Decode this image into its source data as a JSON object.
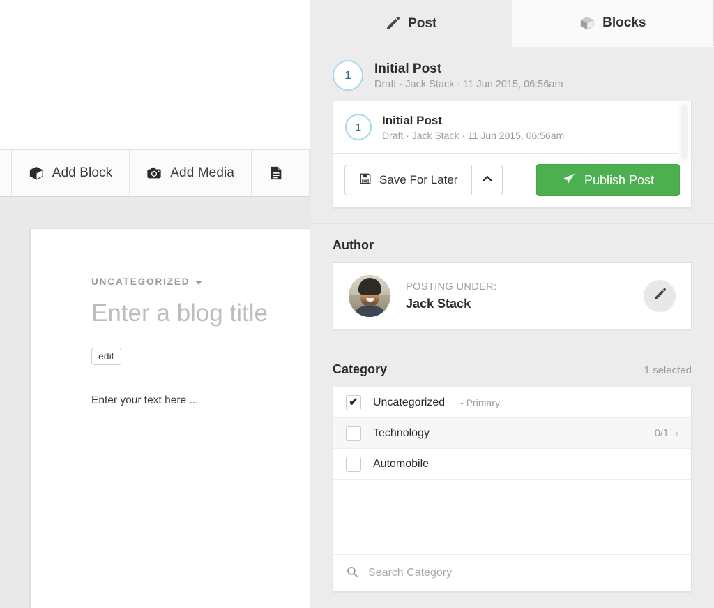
{
  "editor": {
    "toolbar": [
      {
        "label": "Add Block",
        "icon": "cube-icon"
      },
      {
        "label": "Add Media",
        "icon": "camera-icon"
      },
      {
        "label": "",
        "icon": "document-icon"
      }
    ],
    "category_chip": "UNCATEGORIZED",
    "title_placeholder": "Enter a blog title",
    "edit_label": "edit",
    "body_placeholder": "Enter your text here ..."
  },
  "sidebar": {
    "tabs": [
      {
        "label": "Post",
        "icon": "pencil-icon",
        "active": false
      },
      {
        "label": "Blocks",
        "icon": "cube-icon",
        "active": true
      }
    ],
    "post": {
      "number": "1",
      "title": "Initial Post",
      "meta": "Draft · Jack Stack · 11 Jun 2015, 06:56am",
      "list_items": [
        {
          "number": "1",
          "title": "Initial Post",
          "meta": "Draft · Jack Stack · 11 Jun 2015, 06:56am"
        }
      ],
      "save_label": "Save For Later",
      "publish_label": "Publish Post",
      "publish_color": "#4caf50"
    },
    "author": {
      "section_title": "Author",
      "posting_under_label": "POSTING UNDER:",
      "name": "Jack Stack"
    },
    "category": {
      "section_title": "Category",
      "selected_count": "1 selected",
      "items": [
        {
          "name": "Uncategorized",
          "suffix": "- Primary",
          "checked": true,
          "count": "",
          "has_chevron": false
        },
        {
          "name": "Technology",
          "suffix": "",
          "checked": false,
          "count": "0/1",
          "has_chevron": true
        },
        {
          "name": "Automobile",
          "suffix": "",
          "checked": false,
          "count": "",
          "has_chevron": false
        }
      ],
      "search_placeholder": "Search Category"
    }
  }
}
